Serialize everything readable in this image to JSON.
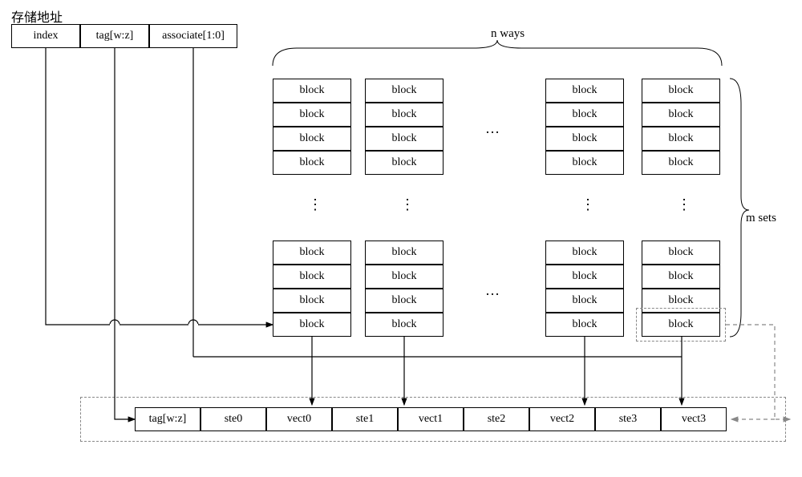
{
  "title": "存储地址",
  "address_fields": {
    "index": "index",
    "tag": "tag[w:z]",
    "associate": "associate[1:0]"
  },
  "labels": {
    "n_ways": "n ways",
    "m_sets": "m sets",
    "ellipsis": "…",
    "vdots": "⋮"
  },
  "block_label": "block",
  "bottom_fields": [
    "tag[w:z]",
    "ste0",
    "vect0",
    "ste1",
    "vect1",
    "ste2",
    "vect2",
    "ste3",
    "vect3"
  ]
}
